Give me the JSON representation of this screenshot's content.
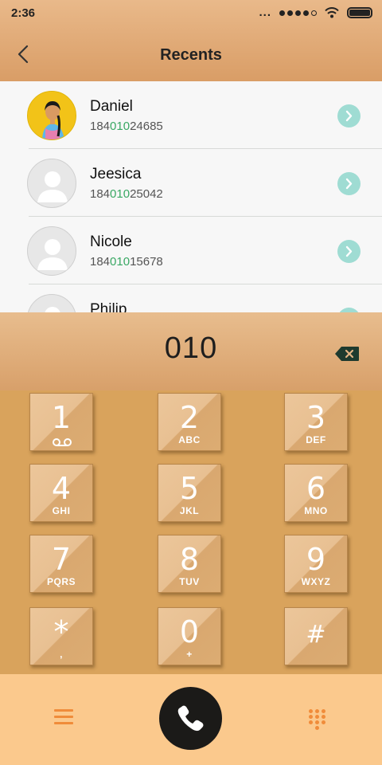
{
  "status_bar": {
    "time": "2:36",
    "more": "..."
  },
  "header": {
    "title": "Recents"
  },
  "contacts": [
    {
      "name": "Daniel",
      "prefix": "184",
      "match": "010",
      "suffix": "24685",
      "avatar": "photo"
    },
    {
      "name": "Jeesica",
      "prefix": "184",
      "match": "010",
      "suffix": "25042",
      "avatar": "default"
    },
    {
      "name": "Nicole",
      "prefix": "184",
      "match": "010",
      "suffix": "15678",
      "avatar": "default"
    },
    {
      "name": "Philip",
      "prefix": "",
      "match": "",
      "suffix": "",
      "avatar": "default"
    }
  ],
  "dialer": {
    "dialed": "010",
    "keys": [
      {
        "digit": "1",
        "letters": "",
        "icon": "voicemail-icon"
      },
      {
        "digit": "2",
        "letters": "ABC"
      },
      {
        "digit": "3",
        "letters": "DEF"
      },
      {
        "digit": "4",
        "letters": "GHI"
      },
      {
        "digit": "5",
        "letters": "JKL"
      },
      {
        "digit": "6",
        "letters": "MNO"
      },
      {
        "digit": "7",
        "letters": "PQRS"
      },
      {
        "digit": "8",
        "letters": "TUV"
      },
      {
        "digit": "9",
        "letters": "WXYZ"
      },
      {
        "digit": "*",
        "letters": ","
      },
      {
        "digit": "0",
        "letters": "+"
      },
      {
        "digit": "#",
        "letters": ""
      }
    ]
  },
  "colors": {
    "header": "#d99d66",
    "keypad_bg": "#d9a35c",
    "bottom_bar": "#fbc98d",
    "match_highlight": "#3aa864",
    "info_button": "#9fdcd3",
    "call_button": "#1b1a18",
    "accent_icon": "#f08c3a"
  },
  "icons": {
    "back": "back-arrow-icon",
    "backspace": "backspace-icon",
    "menu": "menu-icon",
    "call": "phone-icon",
    "keypad": "keypad-grid-icon",
    "info": "chevron-right-icon"
  }
}
